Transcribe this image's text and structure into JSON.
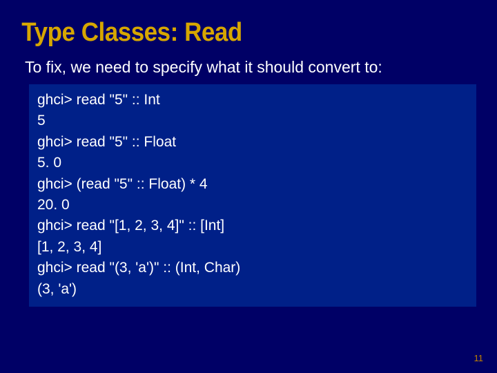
{
  "title": "Type Classes: Read",
  "body": "To fix, we need to specify what it should convert to:",
  "code": [
    "ghci> read \"5\" :: Int",
    "5",
    "ghci> read \"5\" :: Float",
    "5. 0",
    "ghci> (read \"5\" :: Float) * 4",
    "20. 0",
    "ghci> read \"[1, 2, 3, 4]\" :: [Int]",
    "[1, 2, 3, 4]",
    "ghci> read \"(3, 'a')\" :: (Int, Char)",
    "(3, 'a')"
  ],
  "page_number": "11"
}
